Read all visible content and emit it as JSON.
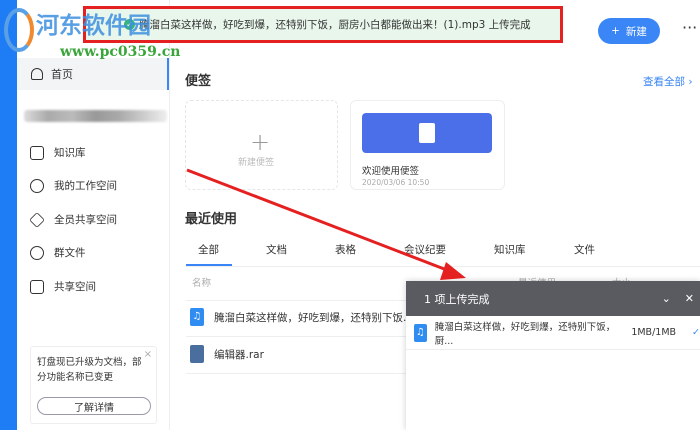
{
  "watermark": {
    "name": "河东软件园",
    "url": "www.pc0359.cn"
  },
  "toast": {
    "message": "腌溜白菜这样做，好吃到爆，还特别下饭，厨房小白都能做出来！(1).mp3 上传完成"
  },
  "header": {
    "new_button": "新建",
    "more": "···"
  },
  "sidebar": {
    "home": "首页",
    "items": [
      {
        "label": "知识库",
        "icon": "book-icon"
      },
      {
        "label": "我的工作空间",
        "icon": "user-icon"
      },
      {
        "label": "全员共享空间",
        "icon": "layers-icon"
      },
      {
        "label": "群文件",
        "icon": "chat-icon"
      },
      {
        "label": "共享空间",
        "icon": "folder-icon"
      }
    ],
    "notice": {
      "text": "钉盘现已升级为文档，部分功能名称已变更",
      "close": "×",
      "button": "了解详情"
    }
  },
  "notes": {
    "title": "便签",
    "view_all": "查看全部 ›",
    "new_note": "新建便签",
    "card": {
      "title": "欢迎使用便签",
      "date": "2020/03/06 10:50"
    }
  },
  "recent": {
    "title": "最近使用",
    "tabs": [
      "全部",
      "文档",
      "表格",
      "会议纪要",
      "知识库",
      "文件"
    ],
    "columns": [
      "名称",
      "最近使用",
      "大小"
    ],
    "rows": [
      {
        "name": "腌溜白菜这样做，好吃到爆，还特别下饭...",
        "type": "audio"
      },
      {
        "name": "编辑器.rar",
        "type": "archive"
      }
    ]
  },
  "upload": {
    "title": "1 项上传完成",
    "file": "腌溜白菜这样做，好吃到爆，还特别下饭，厨...",
    "size": "1MB/1MB",
    "status": "✓"
  },
  "colors": {
    "accent": "#3a86f6",
    "toast_border": "#e52020",
    "panel_header": "#595b60"
  }
}
